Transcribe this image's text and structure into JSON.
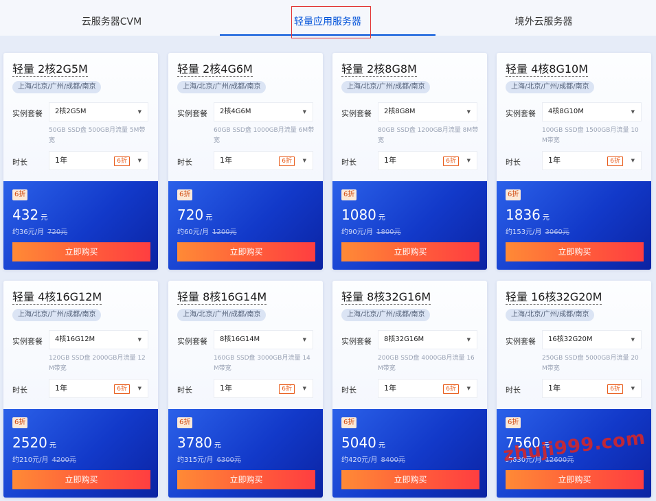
{
  "tabs": [
    {
      "label": "云服务器CVM"
    },
    {
      "label": "轻量应用服务器"
    },
    {
      "label": "境外云服务器"
    }
  ],
  "labels": {
    "spec": "实例套餐",
    "duration": "时长",
    "buy": "立即购买",
    "yuan": "元"
  },
  "cards": [
    {
      "title": "轻量 2核2G5M",
      "region": "上海/北京/广州/成都/南京",
      "spec": "2核2G5M",
      "desc": "50GB SSD盘 500GB月流量 5M带宽",
      "duration": "1年",
      "duration_badge": "6折",
      "discount": "6折",
      "price": "432",
      "monthly": "约36元/月",
      "original": "720元"
    },
    {
      "title": "轻量 2核4G6M",
      "region": "上海/北京/广州/成都/南京",
      "spec": "2核4G6M",
      "desc": "60GB SSD盘 1000GB月流量 6M带宽",
      "duration": "1年",
      "duration_badge": "6折",
      "discount": "6折",
      "price": "720",
      "monthly": "约60元/月",
      "original": "1200元"
    },
    {
      "title": "轻量 2核8G8M",
      "region": "上海/北京/广州/成都/南京",
      "spec": "2核8G8M",
      "desc": "80GB SSD盘 1200GB月流量 8M带宽",
      "duration": "1年",
      "duration_badge": "6折",
      "discount": "6折",
      "price": "1080",
      "monthly": "约90元/月",
      "original": "1800元"
    },
    {
      "title": "轻量 4核8G10M",
      "region": "上海/北京/广州/成都/南京",
      "spec": "4核8G10M",
      "desc": "100GB SSD盘 1500GB月流量 10M带宽",
      "duration": "1年",
      "duration_badge": "6折",
      "discount": "6折",
      "price": "1836",
      "monthly": "约153元/月",
      "original": "3060元"
    },
    {
      "title": "轻量 4核16G12M",
      "region": "上海/北京/广州/成都/南京",
      "spec": "4核16G12M",
      "desc": "120GB SSD盘 2000GB月流量 12M带宽",
      "duration": "1年",
      "duration_badge": "6折",
      "discount": "6折",
      "price": "2520",
      "monthly": "约210元/月",
      "original": "4200元"
    },
    {
      "title": "轻量 8核16G14M",
      "region": "上海/北京/广州/成都/南京",
      "spec": "8核16G14M",
      "desc": "160GB SSD盘 3000GB月流量 14M带宽",
      "duration": "1年",
      "duration_badge": "6折",
      "discount": "6折",
      "price": "3780",
      "monthly": "约315元/月",
      "original": "6300元"
    },
    {
      "title": "轻量 8核32G16M",
      "region": "上海/北京/广州/成都/南京",
      "spec": "8核32G16M",
      "desc": "200GB SSD盘 4000GB月流量 16M带宽",
      "duration": "1年",
      "duration_badge": "6折",
      "discount": "6折",
      "price": "5040",
      "monthly": "约420元/月",
      "original": "8400元"
    },
    {
      "title": "轻量 16核32G20M",
      "region": "上海/北京/广州/成都/南京",
      "spec": "16核32G20M",
      "desc": "250GB SSD盘 5000GB月流量 20M带宽",
      "duration": "1年",
      "duration_badge": "6折",
      "discount": "6折",
      "price": "7560",
      "monthly": "约630元/月",
      "original": "12600元"
    }
  ],
  "watermark": "zhuji999.com"
}
